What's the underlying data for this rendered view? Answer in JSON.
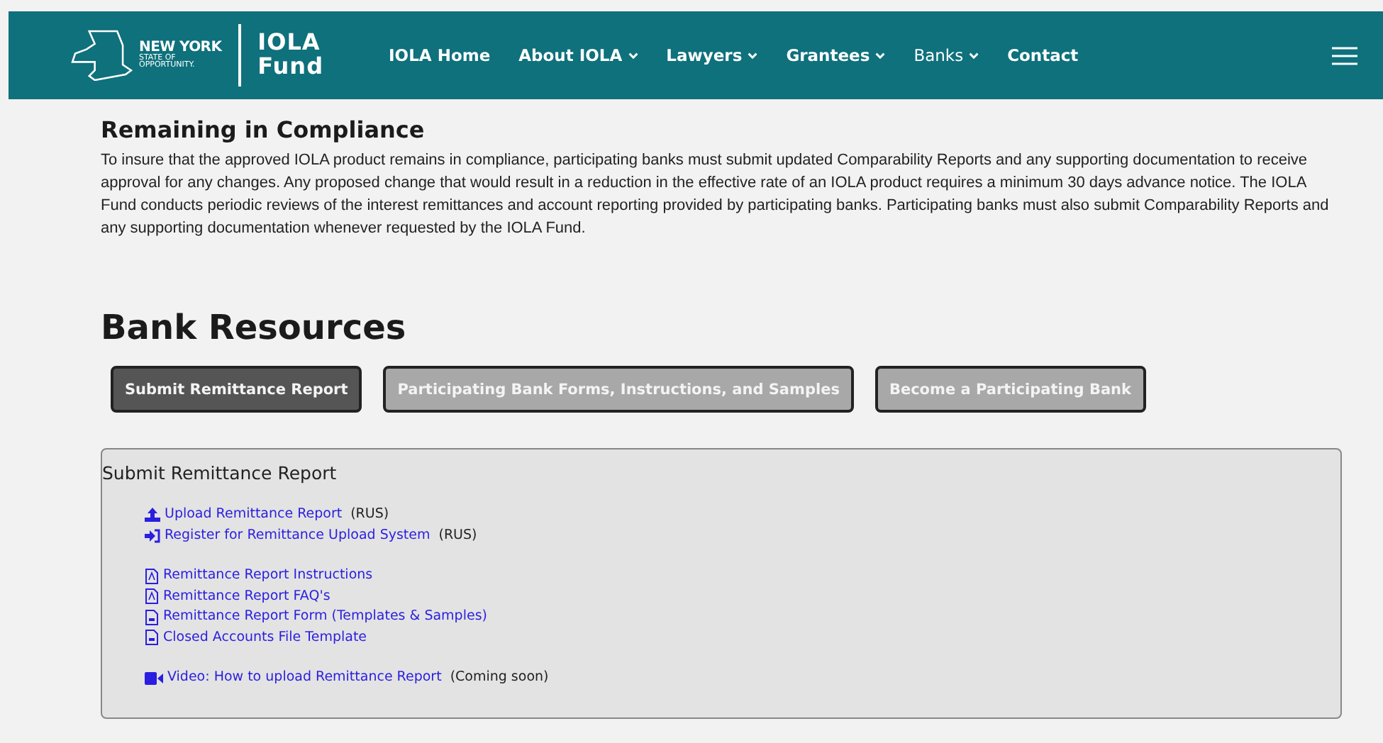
{
  "header": {
    "logo": {
      "state": "NEW YORK",
      "tagline_1": "STATE OF",
      "tagline_2": "OPPORTUNITY.",
      "brand_1": "IOLA",
      "brand_2": "Fund"
    },
    "nav": [
      {
        "label": "IOLA Home",
        "dropdown": false,
        "selected": false
      },
      {
        "label": "About IOLA",
        "dropdown": true,
        "selected": false
      },
      {
        "label": "Lawyers",
        "dropdown": true,
        "selected": false
      },
      {
        "label": "Grantees",
        "dropdown": true,
        "selected": false
      },
      {
        "label": "Banks",
        "dropdown": true,
        "selected": true
      },
      {
        "label": "Contact",
        "dropdown": false,
        "selected": false
      }
    ]
  },
  "compliance": {
    "title": "Remaining in Compliance",
    "body": "To insure that the approved IOLA product remains in compliance, participating banks must submit updated Comparability Reports and any supporting documentation to receive approval for any changes. Any proposed change that would result in a reduction in the effective rate of an IOLA product requires a minimum 30 days advance notice. The IOLA Fund conducts periodic reviews of the interest remittances and account reporting provided by participating banks. Participating banks must also submit Comparability Reports and any supporting documentation whenever requested by the IOLA Fund."
  },
  "resources": {
    "title": "Bank Resources",
    "tabs": [
      {
        "label": "Submit Remittance Report",
        "selected": true
      },
      {
        "label": "Participating Bank Forms, Instructions, and Samples",
        "selected": false
      },
      {
        "label": "Become a Participating Bank",
        "selected": false
      }
    ],
    "panel": {
      "title": "Submit Remittance Report",
      "groups": [
        [
          {
            "kind": "upload",
            "link": "Upload Remittance Report",
            "note": "(RUS)"
          },
          {
            "kind": "signin",
            "link": "Register for Remittance Upload System",
            "note": "(RUS)"
          }
        ],
        [
          {
            "kind": "pdf",
            "link": "Remittance Report Instructions"
          },
          {
            "kind": "pdf",
            "link": "Remittance Report FAQ's"
          },
          {
            "kind": "file",
            "link": "Remittance Report Form (Templates & Samples)"
          },
          {
            "kind": "file",
            "link": "Closed Accounts File Template"
          }
        ],
        [
          {
            "kind": "video",
            "link": "Video: How to upload Remittance Report",
            "note": "(Coming soon)"
          }
        ]
      ]
    }
  }
}
